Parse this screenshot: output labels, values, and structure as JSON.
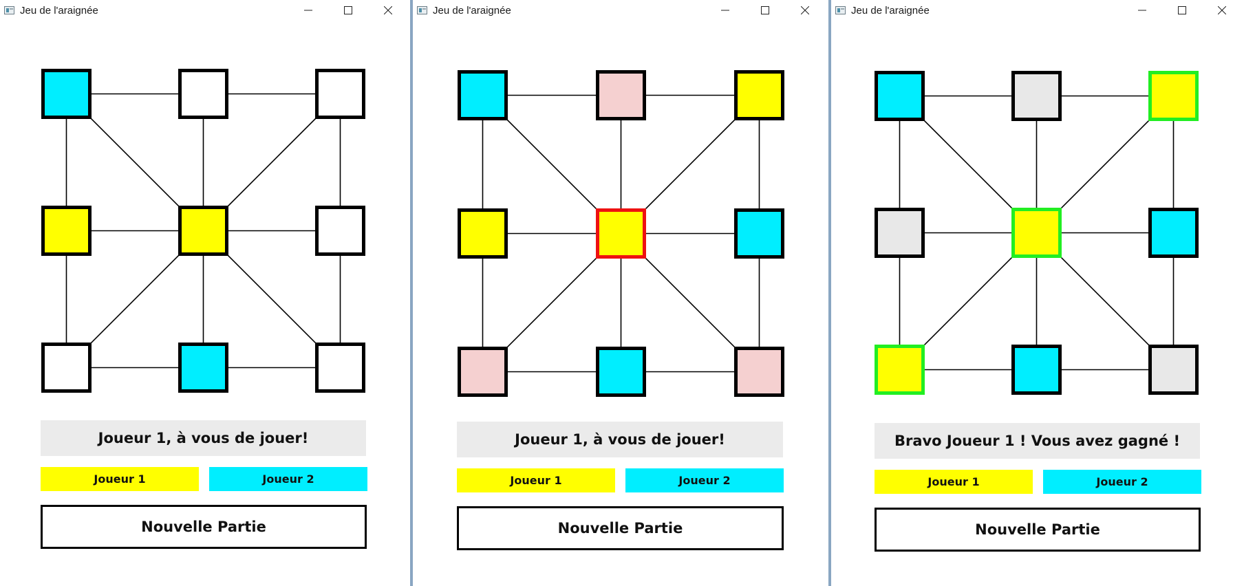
{
  "colors": {
    "player1": "#ffff00",
    "player2": "#00eeff",
    "empty": "#ffffff",
    "hint": "#f5d0d0",
    "disabled": "#e8e8e8",
    "border_default": "#000000",
    "border_selected": "#ee1111",
    "border_win": "#22ee22",
    "status_bg": "#ebebeb"
  },
  "windows": [
    {
      "title": "Jeu de l'araignée",
      "status": "Joueur 1, à vous de jouer!",
      "player1_label": "Joueur 1",
      "player2_label": "Joueur 2",
      "new_game_label": "Nouvelle Partie",
      "cells": [
        {
          "fill": "player2",
          "border": "default"
        },
        {
          "fill": "empty",
          "border": "default"
        },
        {
          "fill": "empty",
          "border": "default"
        },
        {
          "fill": "player1",
          "border": "default"
        },
        {
          "fill": "player1",
          "border": "default"
        },
        {
          "fill": "empty",
          "border": "default"
        },
        {
          "fill": "empty",
          "border": "default"
        },
        {
          "fill": "player2",
          "border": "default"
        },
        {
          "fill": "empty",
          "border": "default"
        }
      ]
    },
    {
      "title": "Jeu de l'araignée",
      "status": "Joueur 1, à vous de jouer!",
      "player1_label": "Joueur 1",
      "player2_label": "Joueur 2",
      "new_game_label": "Nouvelle Partie",
      "cells": [
        {
          "fill": "player2",
          "border": "default"
        },
        {
          "fill": "hint",
          "border": "default"
        },
        {
          "fill": "player1",
          "border": "default"
        },
        {
          "fill": "player1",
          "border": "default"
        },
        {
          "fill": "player1",
          "border": "selected"
        },
        {
          "fill": "player2",
          "border": "default"
        },
        {
          "fill": "hint",
          "border": "default"
        },
        {
          "fill": "player2",
          "border": "default"
        },
        {
          "fill": "hint",
          "border": "default"
        }
      ]
    },
    {
      "title": "Jeu de l'araignée",
      "status": "Bravo Joueur 1 ! Vous avez gagné !",
      "player1_label": "Joueur 1",
      "player2_label": "Joueur 2",
      "new_game_label": "Nouvelle Partie",
      "cells": [
        {
          "fill": "player2",
          "border": "default"
        },
        {
          "fill": "disabled",
          "border": "default"
        },
        {
          "fill": "player1",
          "border": "win"
        },
        {
          "fill": "disabled",
          "border": "default"
        },
        {
          "fill": "player1",
          "border": "win"
        },
        {
          "fill": "player2",
          "border": "default"
        },
        {
          "fill": "player1",
          "border": "win"
        },
        {
          "fill": "player2",
          "border": "default"
        },
        {
          "fill": "disabled",
          "border": "default"
        }
      ]
    }
  ]
}
